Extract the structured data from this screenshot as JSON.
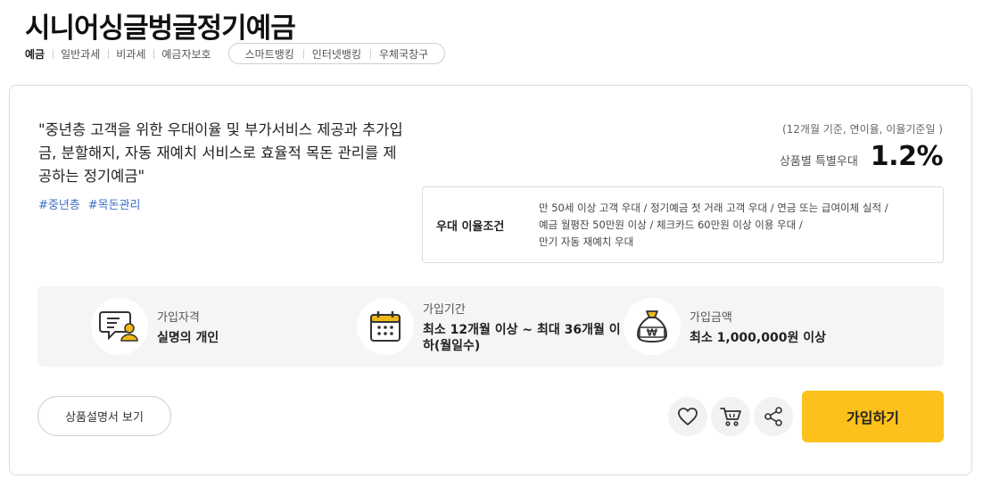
{
  "product": {
    "title": "시니어싱글벙글정기예금"
  },
  "tags": [
    "예금",
    "일반과세",
    "비과세",
    "예금자보호"
  ],
  "channels": [
    "스마트뱅킹",
    "인터넷뱅킹",
    "우체국창구"
  ],
  "description": {
    "text": "\"중년층 고객을 위한 우대이율 및 부가서비스 제공과 추가입금, 분할해지, 자동 재예치 서비스로 효율적 목돈 관리를 제공하는 정기예금\"",
    "hashtags": [
      "#중년층",
      "#목돈관리"
    ]
  },
  "rate": {
    "basis": "(12개월 기준, 연이율, 이율기준일 )",
    "label": "상품별 특별우대",
    "value": "1.2%"
  },
  "preferential": {
    "title": "우대 이율조건",
    "line1": "만 50세 이상 고객 우대  /  정기예금 첫 거래 고객 우대  /  연금 또는 급여이체 실적  /",
    "line2": "예금 월평잔 50만원 이상  /  체크카드 60만원 이상 이용 우대  /",
    "line3": "만기 자동 재예치 우대"
  },
  "info": {
    "eligibility": {
      "label": "가입자격",
      "value": "실명의 개인",
      "icon": "person-document-icon"
    },
    "period": {
      "label": "가입기간",
      "value": "최소 12개월 이상 ~ 최대 36개월 이하(월일수)",
      "icon": "calendar-icon"
    },
    "amount": {
      "label": "가입금액",
      "value": "최소 1,000,000원 이상",
      "icon": "money-bag-icon"
    }
  },
  "actions": {
    "doc_label": "상품설명서 보기",
    "join_label": "가입하기",
    "icons": [
      "heart-icon",
      "cart-icon",
      "share-icon"
    ]
  },
  "colors": {
    "accent": "#fcc11a",
    "hashtag": "#3d6fc4",
    "icon_yellow": "#f0b818"
  }
}
